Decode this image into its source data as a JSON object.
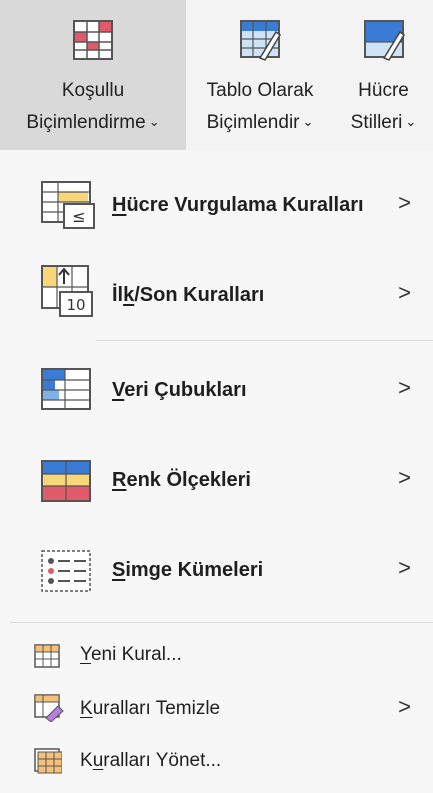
{
  "ribbon": {
    "conditional": {
      "line1": "Koşullu",
      "line2": "Biçimlendirme"
    },
    "format_table": {
      "line1": "Tablo Olarak",
      "line2": "Biçimlendir"
    },
    "cell_styles": {
      "line1": "Hücre",
      "line2": "Stilleri"
    }
  },
  "menu": {
    "highlight": {
      "key": "H",
      "rest": "ücre Vurgulama Kuralları"
    },
    "topbottom": {
      "pre": "İl",
      "key": "k",
      "rest": "/Son Kuralları"
    },
    "databars": {
      "key": "V",
      "rest": "eri Çubukları"
    },
    "colorscales": {
      "key": "R",
      "rest": "enk Ölçekleri"
    },
    "iconsets": {
      "key": "S",
      "rest": "imge Kümeleri"
    },
    "newrule": {
      "key": "Y",
      "rest": "eni Kural..."
    },
    "clearrules": {
      "key": "K",
      "rest": "uralları Temizle"
    },
    "managerules": {
      "pre": "K",
      "key": "u",
      "rest": "ralları Yönet..."
    }
  },
  "icons": {
    "dropdown": "chevron-down-icon",
    "submenu": "chevron-right-icon"
  },
  "glyphs": {
    "submenu_arrow": ">",
    "dropdown_arrow": "⌄",
    "lte": "≤",
    "ten": "10"
  },
  "colors": {
    "active_bg": "#d9d9d9",
    "accent_blue": "#3a7bd5",
    "red": "#e05a6a",
    "yellow": "#f7d77a"
  }
}
